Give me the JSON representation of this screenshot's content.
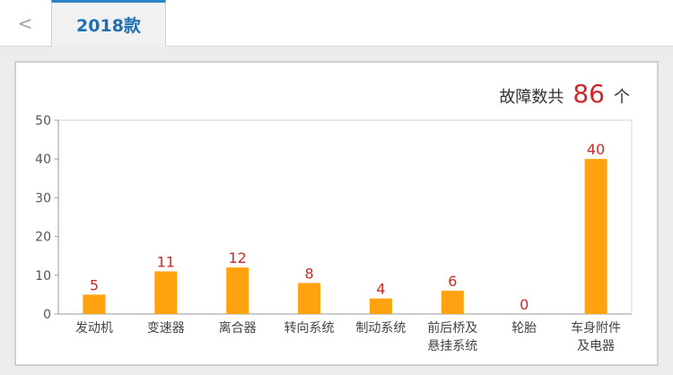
{
  "nav": {
    "back_label": "<",
    "active_tab": "2018款"
  },
  "summary": {
    "prefix": "故障数共",
    "count": "86",
    "suffix": "个"
  },
  "colors": {
    "bar": "#FFA20F",
    "value_label": "#CC2A2A",
    "accent": "#2E86C8"
  },
  "chart_data": {
    "type": "bar",
    "categories": [
      [
        "发动机"
      ],
      [
        "变速器"
      ],
      [
        "离合器"
      ],
      [
        "转向系统"
      ],
      [
        "制动系统"
      ],
      [
        "前后桥及",
        "悬挂系统"
      ],
      [
        "轮胎"
      ],
      [
        "车身附件",
        "及电器"
      ]
    ],
    "values": [
      5,
      11,
      12,
      8,
      4,
      6,
      0,
      40
    ],
    "ylim": [
      0,
      50
    ],
    "yticks": [
      0,
      10,
      20,
      30,
      40,
      50
    ],
    "grid": false,
    "title": "",
    "xlabel": "",
    "ylabel": ""
  }
}
